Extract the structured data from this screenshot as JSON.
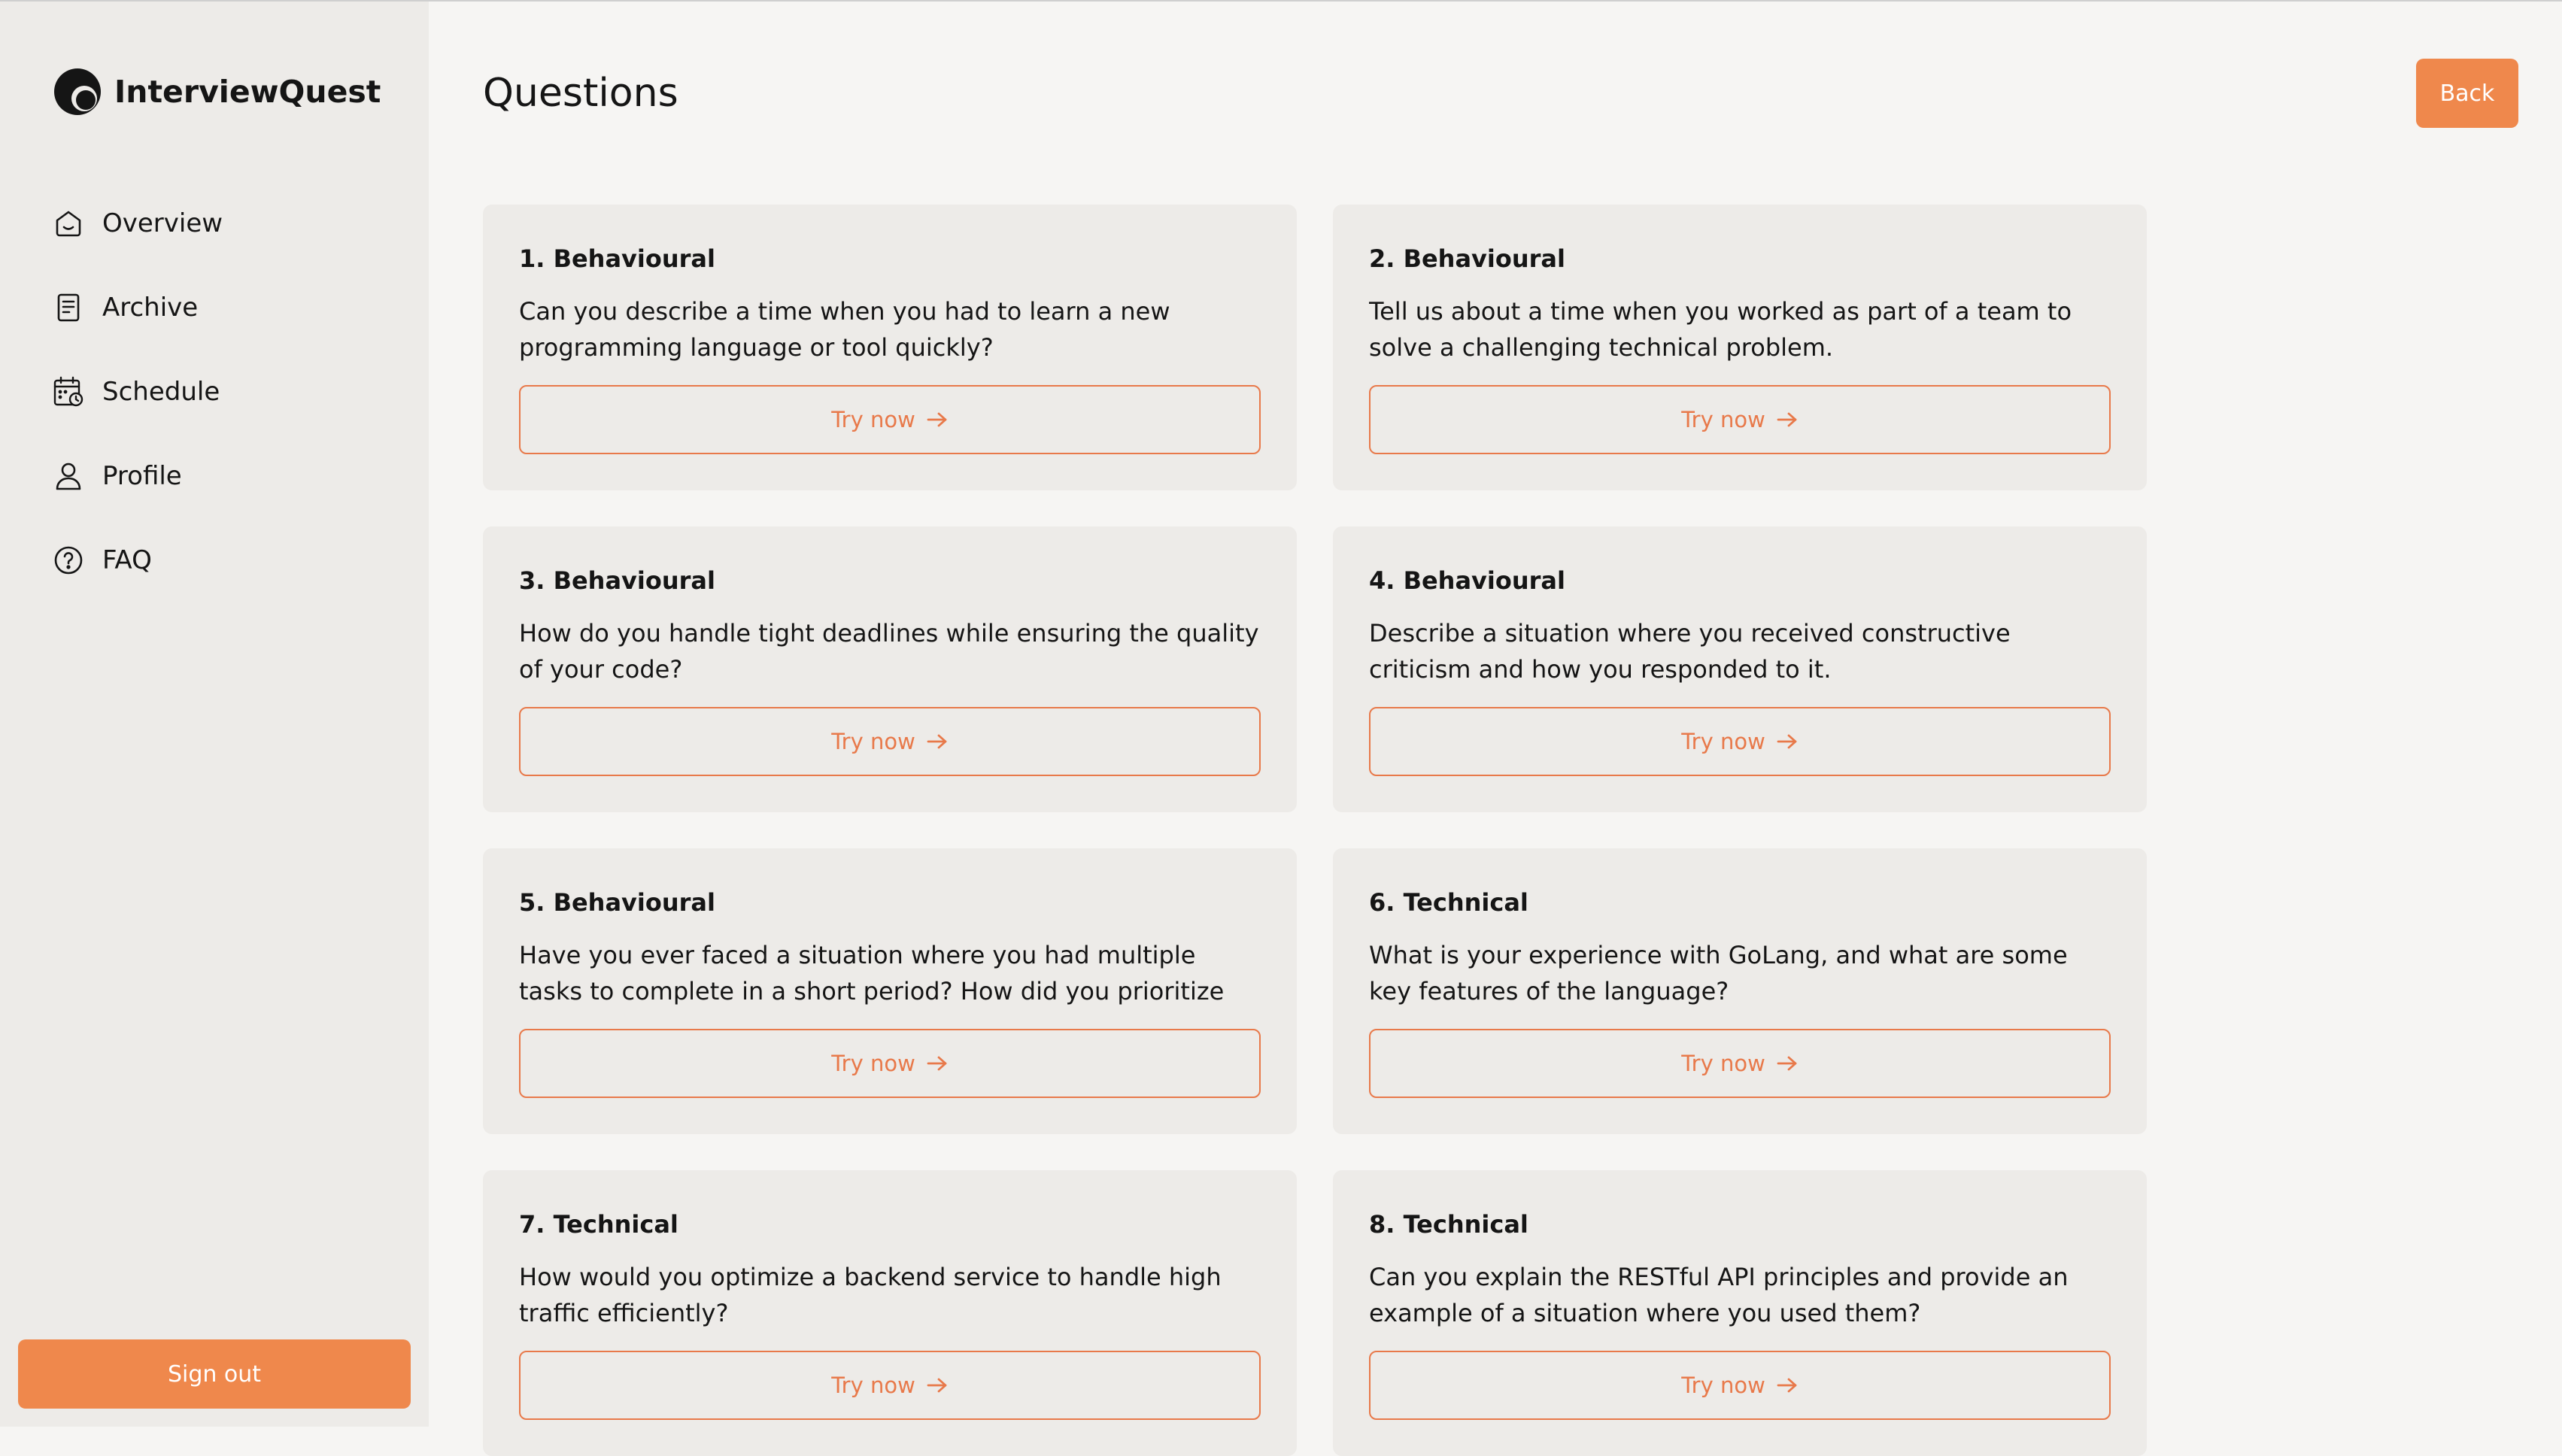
{
  "app": {
    "name": "InterviewQuest",
    "logo_icon": "logo-icon"
  },
  "sidebar": {
    "items": [
      {
        "label": "Overview",
        "icon": "home-icon"
      },
      {
        "label": "Archive",
        "icon": "document-icon"
      },
      {
        "label": "Schedule",
        "icon": "calendar-clock-icon"
      },
      {
        "label": "Profile",
        "icon": "user-icon"
      },
      {
        "label": "FAQ",
        "icon": "help-circle-icon"
      }
    ],
    "signout_label": "Sign out"
  },
  "header": {
    "title": "Questions",
    "back_label": "Back"
  },
  "questions": [
    {
      "title": "1. Behavioural",
      "text": "Can you describe a time when you had to learn a new programming language or tool quickly?",
      "button": "Try now"
    },
    {
      "title": "2. Behavioural",
      "text": "Tell us about a time when you worked as part of a team to solve a challenging technical problem.",
      "button": "Try now"
    },
    {
      "title": "3. Behavioural",
      "text": "How do you handle tight deadlines while ensuring the quality of your code?",
      "button": "Try now"
    },
    {
      "title": "4. Behavioural",
      "text": "Describe a situation where you received constructive criticism and how you responded to it.",
      "button": "Try now"
    },
    {
      "title": "5. Behavioural",
      "text": "Have you ever faced a situation where you had multiple tasks to complete in a short period? How did you prioritize them?",
      "button": "Try now"
    },
    {
      "title": "6. Technical",
      "text": "What is your experience with GoLang, and what are some key features of the language?",
      "button": "Try now"
    },
    {
      "title": "7. Technical",
      "text": "How would you optimize a backend service to handle high traffic efficiently?",
      "button": "Try now"
    },
    {
      "title": "8. Technical",
      "text": "Can you explain the RESTful API principles and provide an example of a situation where you used them?",
      "button": "Try now"
    }
  ],
  "colors": {
    "accent": "#ef884c",
    "accent_outline": "#e8794a",
    "sidebar_bg": "#edebe8",
    "page_bg": "#f6f5f3",
    "card_bg": "#edebe8",
    "text": "#151515"
  }
}
